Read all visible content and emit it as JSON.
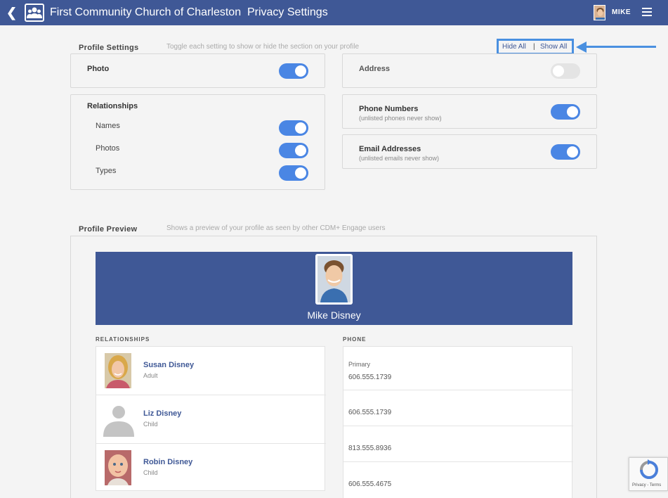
{
  "header": {
    "title": "First Community Church of Charleston  Privacy Settings",
    "user_name": "MIKE",
    "back_icon": "chevron-left-icon",
    "logo_icon": "people-group-icon",
    "menu_icon": "hamburger-menu-icon",
    "bar_color": "#3f5896"
  },
  "profile_settings": {
    "title": "Profile Settings",
    "hint": "Toggle each setting to show or hide the section on your profile",
    "hide_all": "Hide All",
    "separator": "|",
    "show_all": "Show All",
    "photo": {
      "label": "Photo",
      "on": true
    },
    "relationships": {
      "label": "Relationships",
      "items": [
        {
          "label": "Names",
          "on": true
        },
        {
          "label": "Photos",
          "on": true
        },
        {
          "label": "Types",
          "on": true
        }
      ]
    },
    "address": {
      "label": "Address",
      "on": false
    },
    "phone": {
      "label": "Phone Numbers",
      "sub": "(unlisted phones never show)",
      "on": true
    },
    "email": {
      "label": "Email Addresses",
      "sub": "(unlisted emails never show)",
      "on": true
    },
    "toggle_on_color": "#4a86e4"
  },
  "profile_preview": {
    "title": "Profile Preview",
    "hint": "Shows a preview of your profile as seen by other CDM+ Engage users",
    "name": "Mike Disney",
    "relationships_heading": "RELATIONSHIPS",
    "phone_heading": "PHONE",
    "relationships": [
      {
        "name": "Susan Disney",
        "type": "Adult"
      },
      {
        "name": "Liz Disney",
        "type": "Child"
      },
      {
        "name": "Robin Disney",
        "type": "Child"
      }
    ],
    "phones": [
      {
        "label": "Primary",
        "number": "606.555.1739"
      },
      {
        "label": "",
        "number": "606.555.1739"
      },
      {
        "label": "",
        "number": "813.555.8936"
      },
      {
        "label": "",
        "number": "606.555.4675"
      }
    ]
  },
  "recaptcha": {
    "text": "Privacy - Terms"
  }
}
